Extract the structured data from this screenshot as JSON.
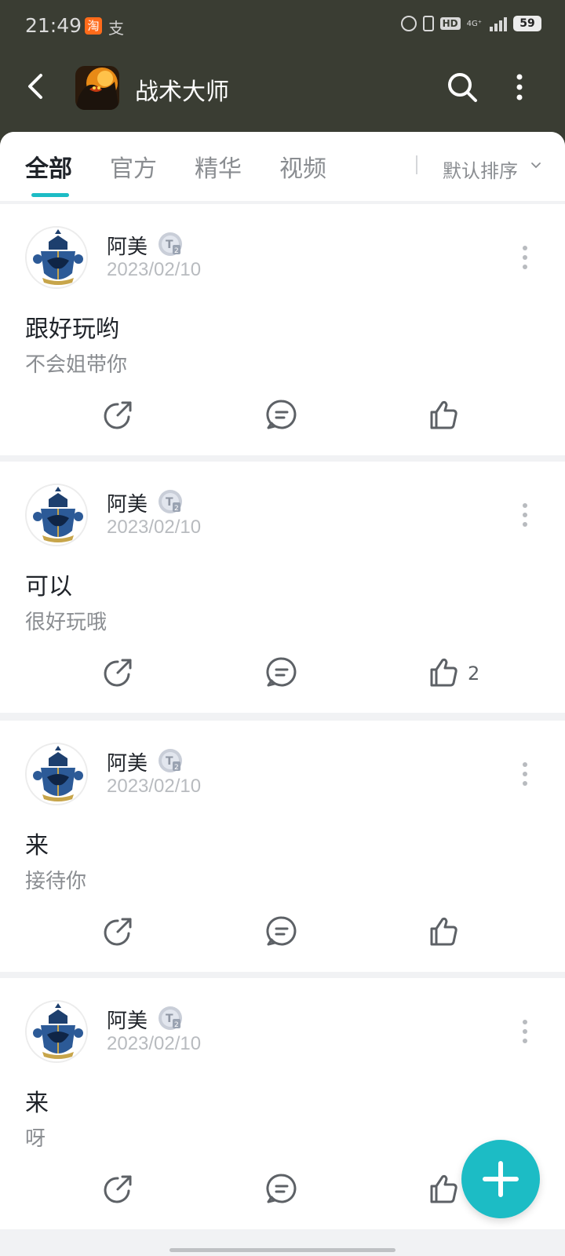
{
  "status": {
    "time": "21:49",
    "app1": "淘",
    "app2": "支",
    "net": "4G⁺",
    "hd": "HD",
    "battery": "59"
  },
  "header": {
    "title": "战术大师"
  },
  "tabs": [
    {
      "label": "全部"
    },
    {
      "label": "官方"
    },
    {
      "label": "精华"
    },
    {
      "label": "视频"
    }
  ],
  "sort": {
    "label": "默认排序"
  },
  "posts": [
    {
      "author": "阿美",
      "date": "2023/02/10",
      "title": "跟好玩哟",
      "body": "不会姐带你",
      "likes": ""
    },
    {
      "author": "阿美",
      "date": "2023/02/10",
      "title": "可以",
      "body": "很好玩哦",
      "likes": "2"
    },
    {
      "author": "阿美",
      "date": "2023/02/10",
      "title": "来",
      "body": "接待你",
      "likes": ""
    },
    {
      "author": "阿美",
      "date": "2023/02/10",
      "title": "来",
      "body": "呀",
      "likes": ""
    }
  ],
  "colors": {
    "accent": "#1cbcc5",
    "header_bg": "#3a3d33",
    "text_primary": "#1f2329",
    "text_secondary": "#8a8d91"
  },
  "icons": {
    "back": "chevron-left-icon",
    "search": "search-icon",
    "more": "vertical-dots-icon",
    "share": "share-icon",
    "comment": "comment-icon",
    "like": "thumbs-up-icon",
    "add": "plus-icon"
  }
}
